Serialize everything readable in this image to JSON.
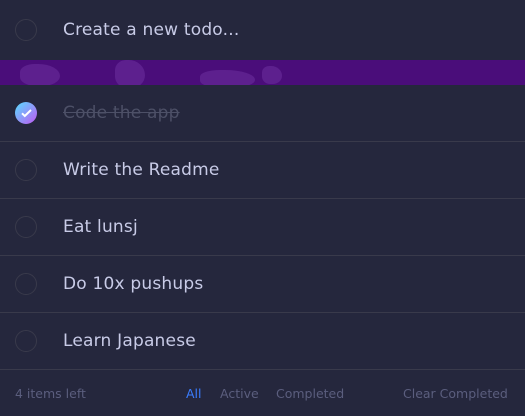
{
  "new_todo": {
    "placeholder": "Create a new todo..."
  },
  "todos": [
    {
      "text": "Code the app",
      "completed": true
    },
    {
      "text": "Write the Readme",
      "completed": false
    },
    {
      "text": "Eat lunsj",
      "completed": false
    },
    {
      "text": "Do 10x pushups",
      "completed": false
    },
    {
      "text": "Learn Japanese",
      "completed": false
    }
  ],
  "footer": {
    "items_left": "4 items left",
    "filters": [
      "All",
      "Active",
      "Completed"
    ],
    "active_filter": "All",
    "clear_label": "Clear Completed"
  },
  "colors": {
    "background": "#171823",
    "card": "#25273D",
    "divider": "#393A4B",
    "text": "#C8CBE7",
    "completed_text": "#4D5067",
    "muted": "#5B5E7E",
    "accent": "#3A7CFD",
    "check_gradient_start": "#57DDFF",
    "check_gradient_end": "#C058F3"
  },
  "icons": {
    "check": "check-icon",
    "circle": "circle-icon"
  }
}
